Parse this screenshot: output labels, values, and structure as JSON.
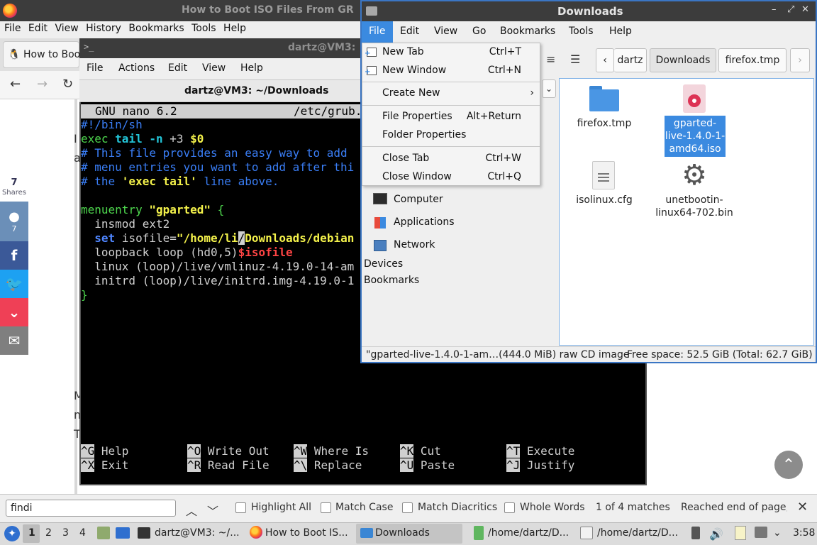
{
  "firefox": {
    "window_title": "How to Boot ISO Files From GR",
    "menu": [
      "File",
      "Edit",
      "View",
      "History",
      "Bookmarks",
      "Tools",
      "Help"
    ],
    "tab_label": "How to Boot",
    "share_count": "7",
    "share_label": "Shares",
    "reddit_count": "7",
    "page_fragments": [
      "I",
      "a",
      "M",
      "m",
      "T"
    ]
  },
  "terminal": {
    "window_title": "dartz@VM3:",
    "menu": [
      "File",
      "Actions",
      "Edit",
      "View",
      "Help"
    ],
    "tab_title": "dartz@VM3: ~/Downloads",
    "nano_version": "GNU nano 6.2",
    "nano_file": "/etc/grub.",
    "lines": {
      "l1": "#!/bin/sh",
      "l2_exec": "exec",
      "l2_tail": "tail",
      "l2_n": "-n",
      "l2_num": "+3",
      "l2_var": "$0",
      "l3": "# This file provides an easy way to add",
      "l4": "# menu entries you want to add after thi",
      "l5_a": "# the ",
      "l5_b": "'exec tail'",
      "l5_c": " line above.",
      "l7_a": "menuentry ",
      "l7_b": "\"gparted\"",
      "l7_c": " {",
      "l8": "  insmod ext2",
      "l9_set": "set",
      "l9_var": " isofile=",
      "l9_str1": "\"/home/li",
      "l9_cur": "/",
      "l9_str2": "Downloads/debian",
      "l10_a": "  loopback loop ",
      "l10_b": "(hd0,5)",
      "l10_c": "$isofile",
      "l11_a": "  linux ",
      "l11_b": "(loop)",
      "l11_c": "/live/vmlinuz-4.19.0-14-am",
      "l12_a": "  initrd ",
      "l12_b": "(loop)",
      "l12_c": "/live/initrd.img-4.19.0-1",
      "l13": "}"
    },
    "shortcuts": [
      {
        "key": "^G",
        "label": "Help"
      },
      {
        "key": "^O",
        "label": "Write Out"
      },
      {
        "key": "^W",
        "label": "Where Is"
      },
      {
        "key": "^K",
        "label": "Cut"
      },
      {
        "key": "^T",
        "label": "Execute"
      },
      {
        "key": "^X",
        "label": "Exit"
      },
      {
        "key": "^R",
        "label": "Read File"
      },
      {
        "key": "^\\",
        "label": "Replace"
      },
      {
        "key": "^U",
        "label": "Paste"
      },
      {
        "key": "^J",
        "label": "Justify"
      }
    ]
  },
  "file_manager": {
    "window_title": "Downloads",
    "menu": [
      "File",
      "Edit",
      "View",
      "Go",
      "Bookmarks",
      "Tools",
      "Help"
    ],
    "breadcrumbs": [
      "dartz",
      "Downloads",
      "firefox.tmp"
    ],
    "file_menu": [
      {
        "label": "New Tab",
        "accel": "Ctrl+T"
      },
      {
        "label": "New Window",
        "accel": "Ctrl+N"
      },
      {
        "label": "Create New",
        "accel": ""
      },
      {
        "label": "File Properties",
        "accel": "Alt+Return"
      },
      {
        "label": "Folder Properties",
        "accel": ""
      },
      {
        "label": "Close Tab",
        "accel": "Ctrl+W"
      },
      {
        "label": "Close Window",
        "accel": "Ctrl+Q"
      }
    ],
    "sidebar": [
      "Computer",
      "Applications",
      "Network",
      "Devices",
      "Bookmarks"
    ],
    "files": [
      {
        "name": "firefox.tmp"
      },
      {
        "name": "gparted-live-1.4.0-1-amd64.iso",
        "lines": [
          "gparted-",
          "live-1.4.0-1-",
          "amd64.iso"
        ]
      },
      {
        "name": "isolinux.cfg"
      },
      {
        "name": "unetbootin-linux64-702.bin",
        "lines": [
          "unetbootin-",
          "linux64-702.bin"
        ]
      }
    ],
    "status_selected": "\"gparted-live-1.4.0-1-am…(444.0 MiB) raw CD image",
    "status_free": "Free space: 52.5 GiB (Total: 62.7 GiB)"
  },
  "findbar": {
    "query": "findi",
    "highlight_all": "Highlight All",
    "match_case": "Match Case",
    "match_diacritics": "Match Diacritics",
    "whole_words": "Whole Words",
    "matches": "1 of 4 matches",
    "status": "Reached end of page, c"
  },
  "taskbar": {
    "workspaces": [
      "1",
      "2",
      "3",
      "4"
    ],
    "tasks": [
      "dartz@VM3: ~/...",
      "How to Boot IS...",
      "Downloads",
      "/home/dartz/D...",
      "/home/dartz/D..."
    ],
    "clock": "3:58"
  },
  "colors": {
    "accent": "#3b8ae0",
    "titlebar": "#3c3c3c",
    "facebook": "#3b5998",
    "twitter": "#1da1f2",
    "pocket": "#ef4056",
    "reddit": "#6b8fb8",
    "email": "#7f7f7f"
  }
}
